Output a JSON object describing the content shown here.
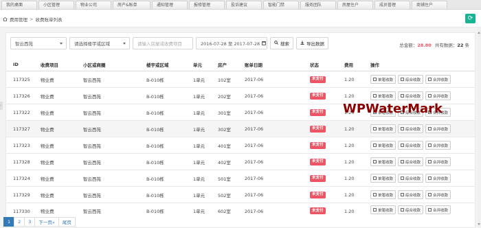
{
  "tabs": [
    "我的桌面",
    "小区管理",
    "物业公司",
    "房产&账单",
    "通知管理",
    "报修管理",
    "投诉建议",
    "智能门禁",
    "服务团队",
    "房屋住户",
    "成员管理",
    "商铺住户"
  ],
  "breadcrumb": {
    "root": "费用管理",
    "current": "收费账单列表"
  },
  "filters": {
    "community": "智云西苑",
    "building_placeholder": "请选择楼宇或区域",
    "search_placeholder": "请输入房屋或收费项目",
    "date_range": "2016-07-28 至 2017-07-28",
    "search_button": "搜索",
    "export_button": "导出数据"
  },
  "summary": {
    "total_label": "总金额：",
    "total_value": "28.80",
    "count_label": "共有数据：",
    "count_value": "22",
    "count_unit": "条"
  },
  "table": {
    "headers": [
      "ID",
      "收费项目",
      "小区或商圈",
      "楼宇或区域",
      "单元",
      "房产",
      "账单日期",
      "状态",
      "费用",
      "操作"
    ],
    "rows": [
      [
        "117325",
        "物业费",
        "智云西苑",
        "B-010栋",
        "1单元",
        "102室",
        "2017-06",
        "未支付",
        "1.20"
      ],
      [
        "117326",
        "物业费",
        "智云西苑",
        "B-010栋",
        "1单元",
        "202室",
        "2017-06",
        "未支付",
        "1.20"
      ],
      [
        "117322",
        "物业费",
        "智云西苑",
        "B-010栋",
        "1单元",
        "301室",
        "2017-06",
        "未支付",
        "1.20"
      ],
      [
        "117327",
        "物业费",
        "智云西苑",
        "B-010栋",
        "1单元",
        "302室",
        "2017-06",
        "未支付",
        "1.20"
      ],
      [
        "117323",
        "物业费",
        "智云西苑",
        "B-010栋",
        "1单元",
        "401室",
        "2017-06",
        "未支付",
        "1.20"
      ],
      [
        "117328",
        "物业费",
        "智云西苑",
        "B-010栋",
        "1单元",
        "402室",
        "2017-06",
        "未支付",
        "1.20"
      ],
      [
        "117324",
        "物业费",
        "智云西苑",
        "B-010栋",
        "1单元",
        "501室",
        "2017-06",
        "未支付",
        "1.20"
      ],
      [
        "117329",
        "物业费",
        "智云西苑",
        "B-010栋",
        "1单元",
        "502室",
        "2017-06",
        "未支付",
        "1.20"
      ],
      [
        "117330",
        "物业费",
        "智云西苑",
        "B-010栋",
        "1单元",
        "602室",
        "2017-06",
        "未支付",
        "1.20"
      ]
    ],
    "actions": [
      "单笔收款",
      "综合收款",
      "合并收款"
    ]
  },
  "pagination": {
    "pages": [
      "1",
      "2",
      "3"
    ],
    "next": "下一页»",
    "last": "尾页",
    "active": "1"
  },
  "watermark": "WPWaterMark",
  "colors": {
    "accent_green": "#1ab394",
    "unpaid_red": "#ed5565",
    "pager_blue": "#337ab7"
  }
}
